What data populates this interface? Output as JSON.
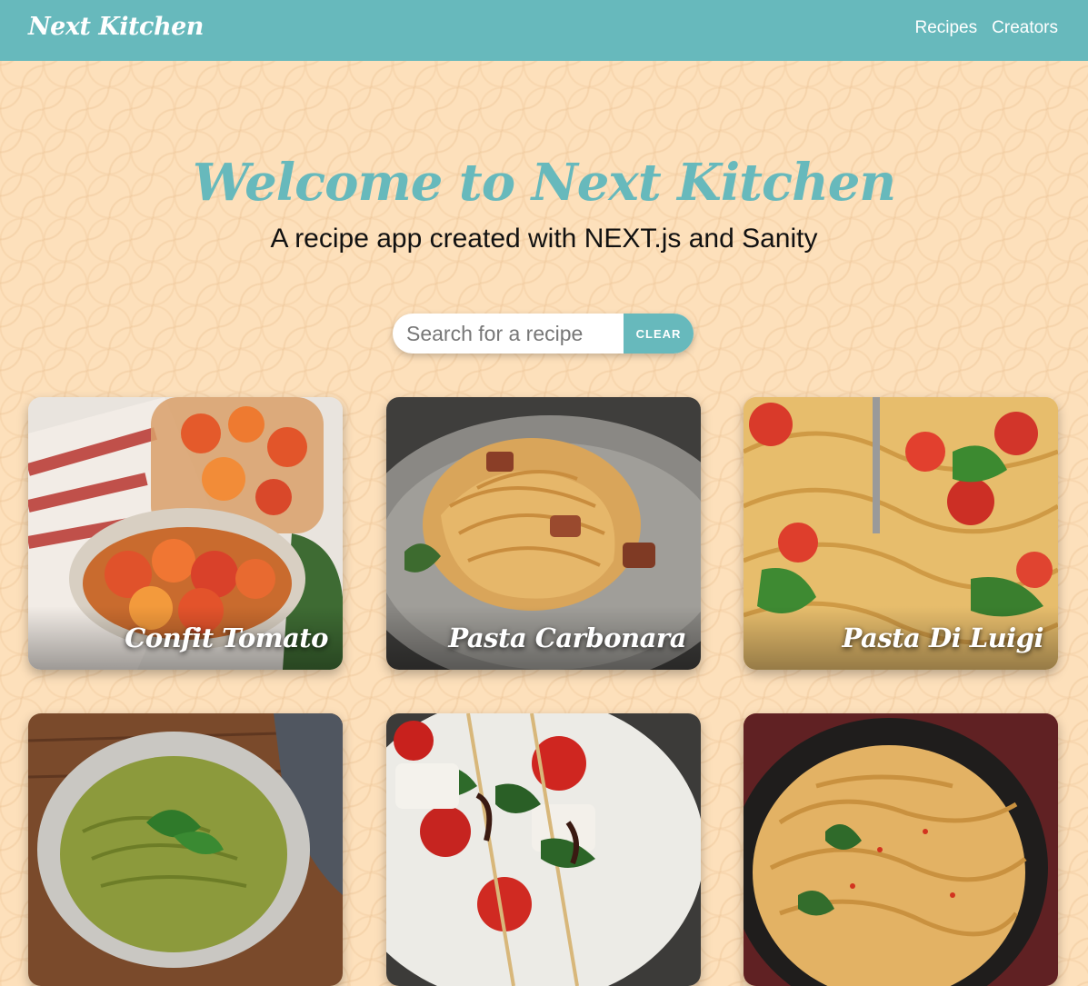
{
  "header": {
    "brand": "Next Kitchen",
    "nav": [
      {
        "label": "Recipes"
      },
      {
        "label": "Creators"
      }
    ]
  },
  "hero": {
    "title": "Welcome to Next Kitchen",
    "subtitle": "A recipe app created with NEXT.js and Sanity"
  },
  "search": {
    "placeholder": "Search for a recipe",
    "value": "",
    "clear_label": "CLEAR"
  },
  "recipes": [
    {
      "title": "Confit Tomato"
    },
    {
      "title": "Pasta Carbonara"
    },
    {
      "title": "Pasta Di Luigi"
    },
    {
      "title": ""
    },
    {
      "title": ""
    },
    {
      "title": ""
    }
  ],
  "colors": {
    "accent": "#67b9bc",
    "background": "#fde0bb",
    "text": "#111111"
  }
}
